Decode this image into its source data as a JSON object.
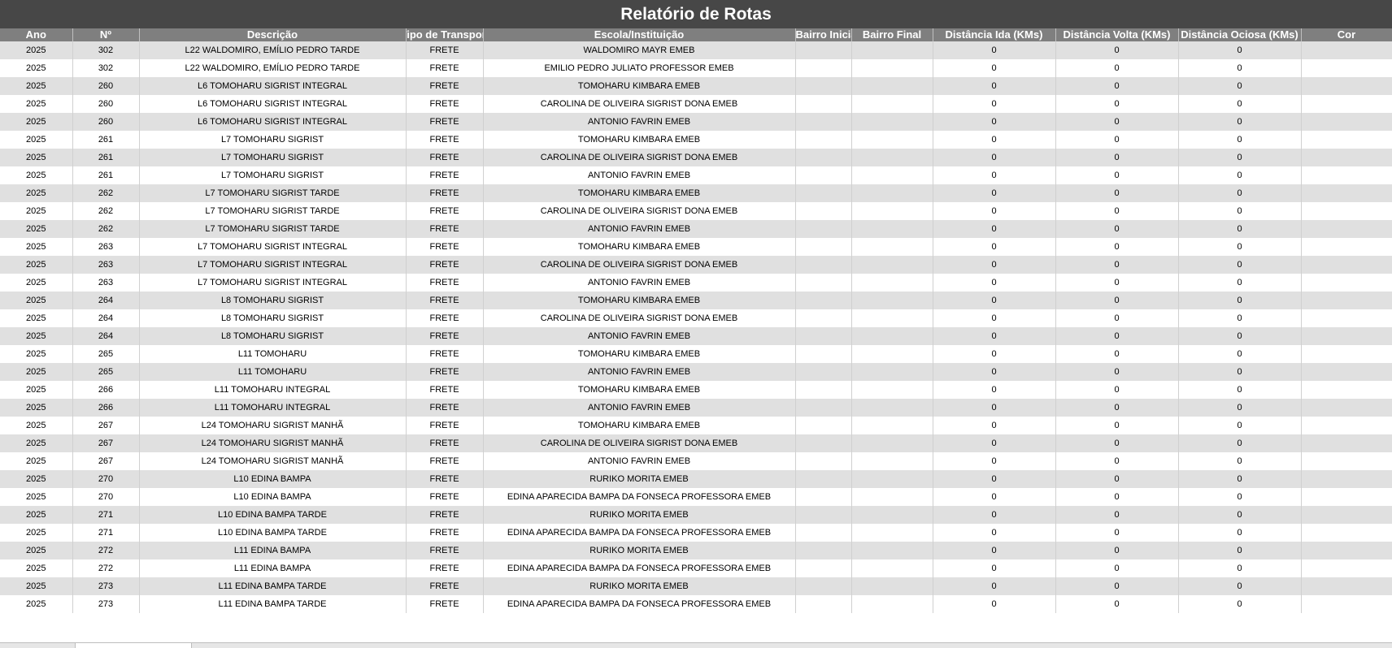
{
  "title": "Relatório de Rotas",
  "columns": [
    "Ano",
    "Nº",
    "Descrição",
    "Tipo de Transporte",
    "Escola/Instituição",
    "Bairro Inicial",
    "Bairro Final",
    "Distância Ida (KMs)",
    "Distância Volta (KMs)",
    "Distância Ociosa (KMs)",
    "Cor"
  ],
  "rows": [
    [
      "2025",
      "302",
      "L22 WALDOMIRO, EMÍLIO PEDRO TARDE",
      "FRETE",
      "WALDOMIRO MAYR EMEB",
      "",
      "",
      "0",
      "0",
      "0",
      ""
    ],
    [
      "2025",
      "302",
      "L22 WALDOMIRO, EMÍLIO PEDRO TARDE",
      "FRETE",
      "EMILIO PEDRO JULIATO PROFESSOR EMEB",
      "",
      "",
      "0",
      "0",
      "0",
      ""
    ],
    [
      "2025",
      "260",
      "L6 TOMOHARU SIGRIST INTEGRAL",
      "FRETE",
      "TOMOHARU KIMBARA EMEB",
      "",
      "",
      "0",
      "0",
      "0",
      ""
    ],
    [
      "2025",
      "260",
      "L6 TOMOHARU SIGRIST INTEGRAL",
      "FRETE",
      "CAROLINA DE OLIVEIRA SIGRIST DONA EMEB",
      "",
      "",
      "0",
      "0",
      "0",
      ""
    ],
    [
      "2025",
      "260",
      "L6 TOMOHARU SIGRIST INTEGRAL",
      "FRETE",
      "ANTONIO FAVRIN EMEB",
      "",
      "",
      "0",
      "0",
      "0",
      ""
    ],
    [
      "2025",
      "261",
      "L7 TOMOHARU SIGRIST",
      "FRETE",
      "TOMOHARU KIMBARA EMEB",
      "",
      "",
      "0",
      "0",
      "0",
      ""
    ],
    [
      "2025",
      "261",
      "L7 TOMOHARU SIGRIST",
      "FRETE",
      "CAROLINA DE OLIVEIRA SIGRIST DONA EMEB",
      "",
      "",
      "0",
      "0",
      "0",
      ""
    ],
    [
      "2025",
      "261",
      "L7 TOMOHARU SIGRIST",
      "FRETE",
      "ANTONIO FAVRIN EMEB",
      "",
      "",
      "0",
      "0",
      "0",
      ""
    ],
    [
      "2025",
      "262",
      "L7 TOMOHARU SIGRIST TARDE",
      "FRETE",
      "TOMOHARU KIMBARA EMEB",
      "",
      "",
      "0",
      "0",
      "0",
      ""
    ],
    [
      "2025",
      "262",
      "L7 TOMOHARU SIGRIST TARDE",
      "FRETE",
      "CAROLINA DE OLIVEIRA SIGRIST DONA EMEB",
      "",
      "",
      "0",
      "0",
      "0",
      ""
    ],
    [
      "2025",
      "262",
      "L7 TOMOHARU SIGRIST TARDE",
      "FRETE",
      "ANTONIO FAVRIN EMEB",
      "",
      "",
      "0",
      "0",
      "0",
      ""
    ],
    [
      "2025",
      "263",
      "L7 TOMOHARU SIGRIST INTEGRAL",
      "FRETE",
      "TOMOHARU KIMBARA EMEB",
      "",
      "",
      "0",
      "0",
      "0",
      ""
    ],
    [
      "2025",
      "263",
      "L7 TOMOHARU SIGRIST INTEGRAL",
      "FRETE",
      "CAROLINA DE OLIVEIRA SIGRIST DONA EMEB",
      "",
      "",
      "0",
      "0",
      "0",
      ""
    ],
    [
      "2025",
      "263",
      "L7 TOMOHARU SIGRIST INTEGRAL",
      "FRETE",
      "ANTONIO FAVRIN EMEB",
      "",
      "",
      "0",
      "0",
      "0",
      ""
    ],
    [
      "2025",
      "264",
      "L8 TOMOHARU SIGRIST",
      "FRETE",
      "TOMOHARU KIMBARA EMEB",
      "",
      "",
      "0",
      "0",
      "0",
      ""
    ],
    [
      "2025",
      "264",
      "L8 TOMOHARU SIGRIST",
      "FRETE",
      "CAROLINA DE OLIVEIRA SIGRIST DONA EMEB",
      "",
      "",
      "0",
      "0",
      "0",
      ""
    ],
    [
      "2025",
      "264",
      "L8 TOMOHARU SIGRIST",
      "FRETE",
      "ANTONIO FAVRIN EMEB",
      "",
      "",
      "0",
      "0",
      "0",
      ""
    ],
    [
      "2025",
      "265",
      "L11 TOMOHARU",
      "FRETE",
      "TOMOHARU KIMBARA EMEB",
      "",
      "",
      "0",
      "0",
      "0",
      ""
    ],
    [
      "2025",
      "265",
      "L11 TOMOHARU",
      "FRETE",
      "ANTONIO FAVRIN EMEB",
      "",
      "",
      "0",
      "0",
      "0",
      ""
    ],
    [
      "2025",
      "266",
      "L11 TOMOHARU INTEGRAL",
      "FRETE",
      "TOMOHARU KIMBARA EMEB",
      "",
      "",
      "0",
      "0",
      "0",
      ""
    ],
    [
      "2025",
      "266",
      "L11 TOMOHARU INTEGRAL",
      "FRETE",
      "ANTONIO FAVRIN EMEB",
      "",
      "",
      "0",
      "0",
      "0",
      ""
    ],
    [
      "2025",
      "267",
      "L24 TOMOHARU SIGRIST MANHÃ",
      "FRETE",
      "TOMOHARU KIMBARA EMEB",
      "",
      "",
      "0",
      "0",
      "0",
      ""
    ],
    [
      "2025",
      "267",
      "L24 TOMOHARU SIGRIST MANHÃ",
      "FRETE",
      "CAROLINA DE OLIVEIRA SIGRIST DONA EMEB",
      "",
      "",
      "0",
      "0",
      "0",
      ""
    ],
    [
      "2025",
      "267",
      "L24 TOMOHARU SIGRIST MANHÃ",
      "FRETE",
      "ANTONIO FAVRIN EMEB",
      "",
      "",
      "0",
      "0",
      "0",
      ""
    ],
    [
      "2025",
      "270",
      "L10 EDINA BAMPA",
      "FRETE",
      "RURIKO MORITA EMEB",
      "",
      "",
      "0",
      "0",
      "0",
      ""
    ],
    [
      "2025",
      "270",
      "L10 EDINA BAMPA",
      "FRETE",
      "EDINA APARECIDA BAMPA DA FONSECA PROFESSORA EMEB",
      "",
      "",
      "0",
      "0",
      "0",
      ""
    ],
    [
      "2025",
      "271",
      "L10 EDINA BAMPA TARDE",
      "FRETE",
      "RURIKO MORITA EMEB",
      "",
      "",
      "0",
      "0",
      "0",
      ""
    ],
    [
      "2025",
      "271",
      "L10 EDINA BAMPA TARDE",
      "FRETE",
      "EDINA APARECIDA BAMPA DA FONSECA PROFESSORA EMEB",
      "",
      "",
      "0",
      "0",
      "0",
      ""
    ],
    [
      "2025",
      "272",
      "L11 EDINA BAMPA",
      "FRETE",
      "RURIKO MORITA EMEB",
      "",
      "",
      "0",
      "0",
      "0",
      ""
    ],
    [
      "2025",
      "272",
      "L11 EDINA BAMPA",
      "FRETE",
      "EDINA APARECIDA BAMPA DA FONSECA PROFESSORA EMEB",
      "",
      "",
      "0",
      "0",
      "0",
      ""
    ],
    [
      "2025",
      "273",
      "L11 EDINA BAMPA TARDE",
      "FRETE",
      "RURIKO MORITA EMEB",
      "",
      "",
      "0",
      "0",
      "0",
      ""
    ],
    [
      "2025",
      "273",
      "L11 EDINA BAMPA TARDE",
      "FRETE",
      "EDINA APARECIDA BAMPA DA FONSECA PROFESSORA EMEB",
      "",
      "",
      "0",
      "0",
      "0",
      ""
    ]
  ],
  "colors": {
    "title_bg": "#474747",
    "header_bg": "#7f7f7f",
    "row_shade": "#e0e0e0",
    "row_plain": "#ffffff"
  }
}
